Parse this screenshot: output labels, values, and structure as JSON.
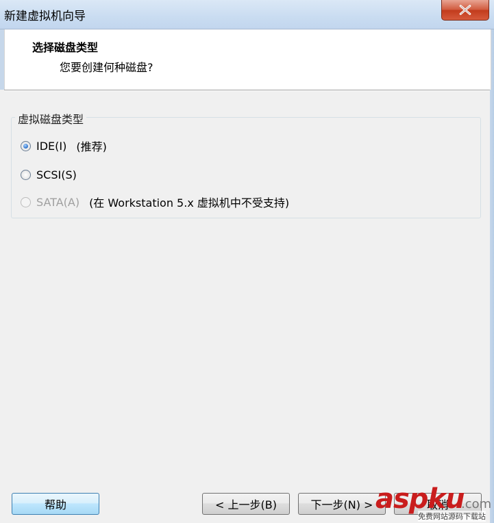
{
  "window": {
    "title": "新建虚拟机向导"
  },
  "header": {
    "title": "选择磁盘类型",
    "subtitle": "您要创建何种磁盘?"
  },
  "disk_type_group": {
    "legend": "虚拟磁盘类型",
    "options": [
      {
        "label": "IDE(I)",
        "note": "(推荐)",
        "selected": true,
        "enabled": true
      },
      {
        "label": "SCSI(S)",
        "note": "",
        "selected": false,
        "enabled": true
      },
      {
        "label": "SATA(A)",
        "note": "(在 Workstation 5.x 虚拟机中不受支持)",
        "selected": false,
        "enabled": false
      }
    ]
  },
  "buttons": {
    "help": "帮助",
    "back": "< 上一步(B)",
    "next": "下一步(N) >",
    "cancel": "取消"
  },
  "watermark": {
    "brand": "aspku",
    "domain": ".com",
    "tagline": "免费网站源码下载站"
  },
  "icons": {
    "close": "close-icon",
    "radio": "radio-button-icon"
  }
}
